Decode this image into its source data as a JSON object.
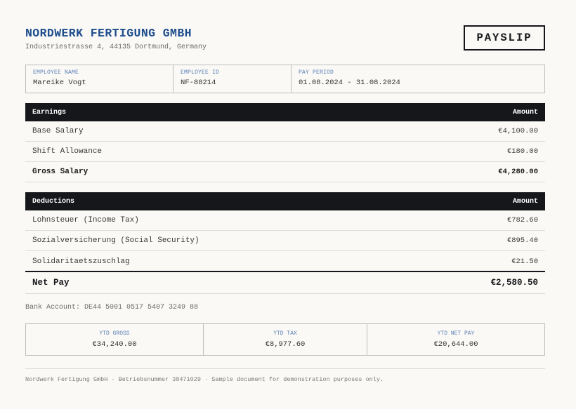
{
  "company": {
    "name": "NORDWERK FERTIGUNG GMBH",
    "address": "Industriestrasse 4, 44135 Dortmund, Germany"
  },
  "document_title": "PAYSLIP",
  "employee": {
    "name_label": "EMPLOYEE NAME",
    "name": "Mareike Vogt",
    "id_label": "EMPLOYEE ID",
    "id": "NF-88214",
    "period_label": "PAY PERIOD",
    "period": "01.08.2024 - 31.08.2024"
  },
  "earnings": {
    "header": "Earnings",
    "amount_header": "Amount",
    "rows": [
      {
        "label": "Base Salary",
        "amount": "€4,100.00"
      },
      {
        "label": "Shift Allowance",
        "amount": "€180.00"
      }
    ],
    "total": {
      "label": "Gross Salary",
      "amount": "€4,280.00"
    }
  },
  "deductions": {
    "header": "Deductions",
    "amount_header": "Amount",
    "rows": [
      {
        "label": "Lohnsteuer (Income Tax)",
        "amount": "€782.60"
      },
      {
        "label": "Sozialversicherung (Social Security)",
        "amount": "€895.40"
      },
      {
        "label": "Solidaritaetszuschlag",
        "amount": "€21.50"
      }
    ]
  },
  "net_pay": {
    "label": "Net Pay",
    "amount": "€2,580.50"
  },
  "bank_account": "Bank Account: DE44 5001 0517 5407 3249 88",
  "ytd": [
    {
      "label": "YTD GROSS",
      "value": "€34,240.00"
    },
    {
      "label": "YTD TAX",
      "value": "€8,977.60"
    },
    {
      "label": "YTD NET PAY",
      "value": "€20,644.00"
    }
  ],
  "footer": "Nordwerk Fertigung GmbH · Betriebsnummer 38471029 · Sample document for demonstration purposes only."
}
